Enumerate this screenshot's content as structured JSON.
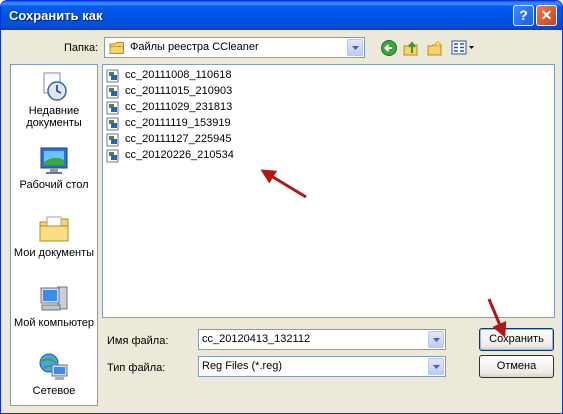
{
  "window": {
    "title": "Сохранить как"
  },
  "titlebar": {
    "help_glyph": "?",
    "close_glyph": "✕"
  },
  "toolbar": {
    "folder_label": "Папка:",
    "folder_value": "Файлы реестра CCleaner",
    "icons": [
      "back-icon",
      "up-folder-icon",
      "new-folder-icon",
      "view-menu-icon"
    ]
  },
  "places": [
    {
      "label": "Недавние документы",
      "icon": "recent-documents-icon"
    },
    {
      "label": "Рабочий стол",
      "icon": "desktop-icon"
    },
    {
      "label": "Мои документы",
      "icon": "my-documents-icon"
    },
    {
      "label": "Мой компьютер",
      "icon": "my-computer-icon"
    },
    {
      "label": "Сетевое",
      "icon": "network-icon"
    }
  ],
  "files": [
    "cc_20111008_110618",
    "cc_20111015_210903",
    "cc_20111029_231813",
    "cc_20111119_153919",
    "cc_20111127_225945",
    "cc_20120226_210534"
  ],
  "form": {
    "filename_label": "Имя файла:",
    "filename_value": "cc_20120413_132112",
    "filetype_label": "Тип файла:",
    "filetype_value": "Reg Files (*.reg)"
  },
  "buttons": {
    "save": "Сохранить",
    "cancel": "Отмена"
  },
  "colors": {
    "titlebar": "#0054e3",
    "dialog_bg": "#ece9d8",
    "annotation_arrow": "#b01818"
  }
}
